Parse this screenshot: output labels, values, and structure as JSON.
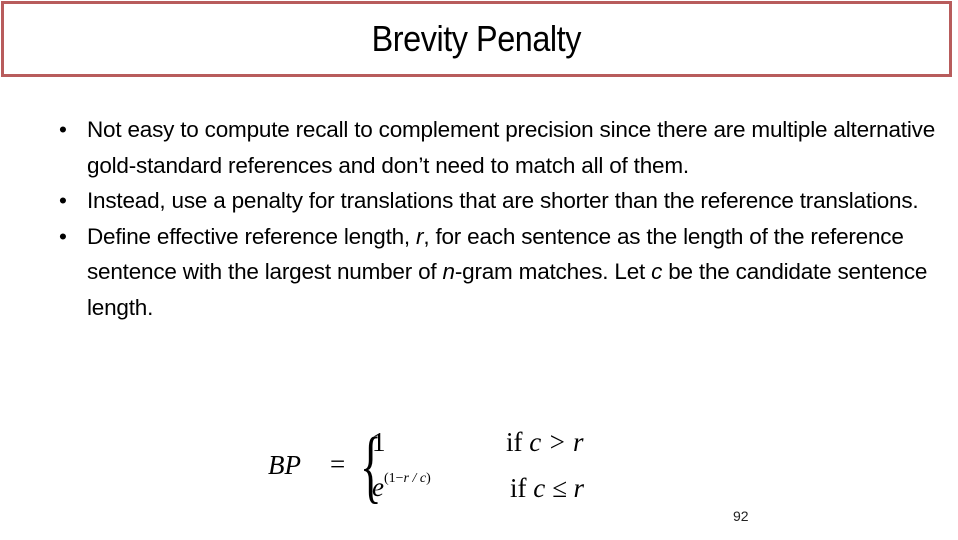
{
  "slide": {
    "title": "Brevity Penalty",
    "page_number": "92",
    "accent_color": "#b85c5c"
  },
  "bullets": [
    {
      "bullet": "•",
      "text": "Not easy to compute recall to complement precision since there are multiple alternative gold-standard references and don’t need to match all of them."
    },
    {
      "bullet": "•",
      "text": "Instead, use a penalty for translations that are shorter than the reference translations."
    },
    {
      "bullet": "•",
      "parts": {
        "p1": "Define effective reference length, ",
        "r": "r",
        "p2": ", for each sentence as the length of the reference sentence with the largest number of ",
        "n": "n",
        "p3": "-gram matches. Let  ",
        "c": "c",
        "p4": " be the candidate sentence length."
      }
    }
  ],
  "formula": {
    "lhs": "BP",
    "equals": "=",
    "brace": "{",
    "case1_value": "1",
    "case1_condition_if": "if ",
    "case1_condition_expr": "c > r",
    "case2_base": "e",
    "case2_exponent_open": "(1−",
    "case2_exponent_var": "r / c",
    "case2_exponent_close": ")",
    "case2_condition_if": "if ",
    "case2_condition_expr": "c ≤ r"
  }
}
